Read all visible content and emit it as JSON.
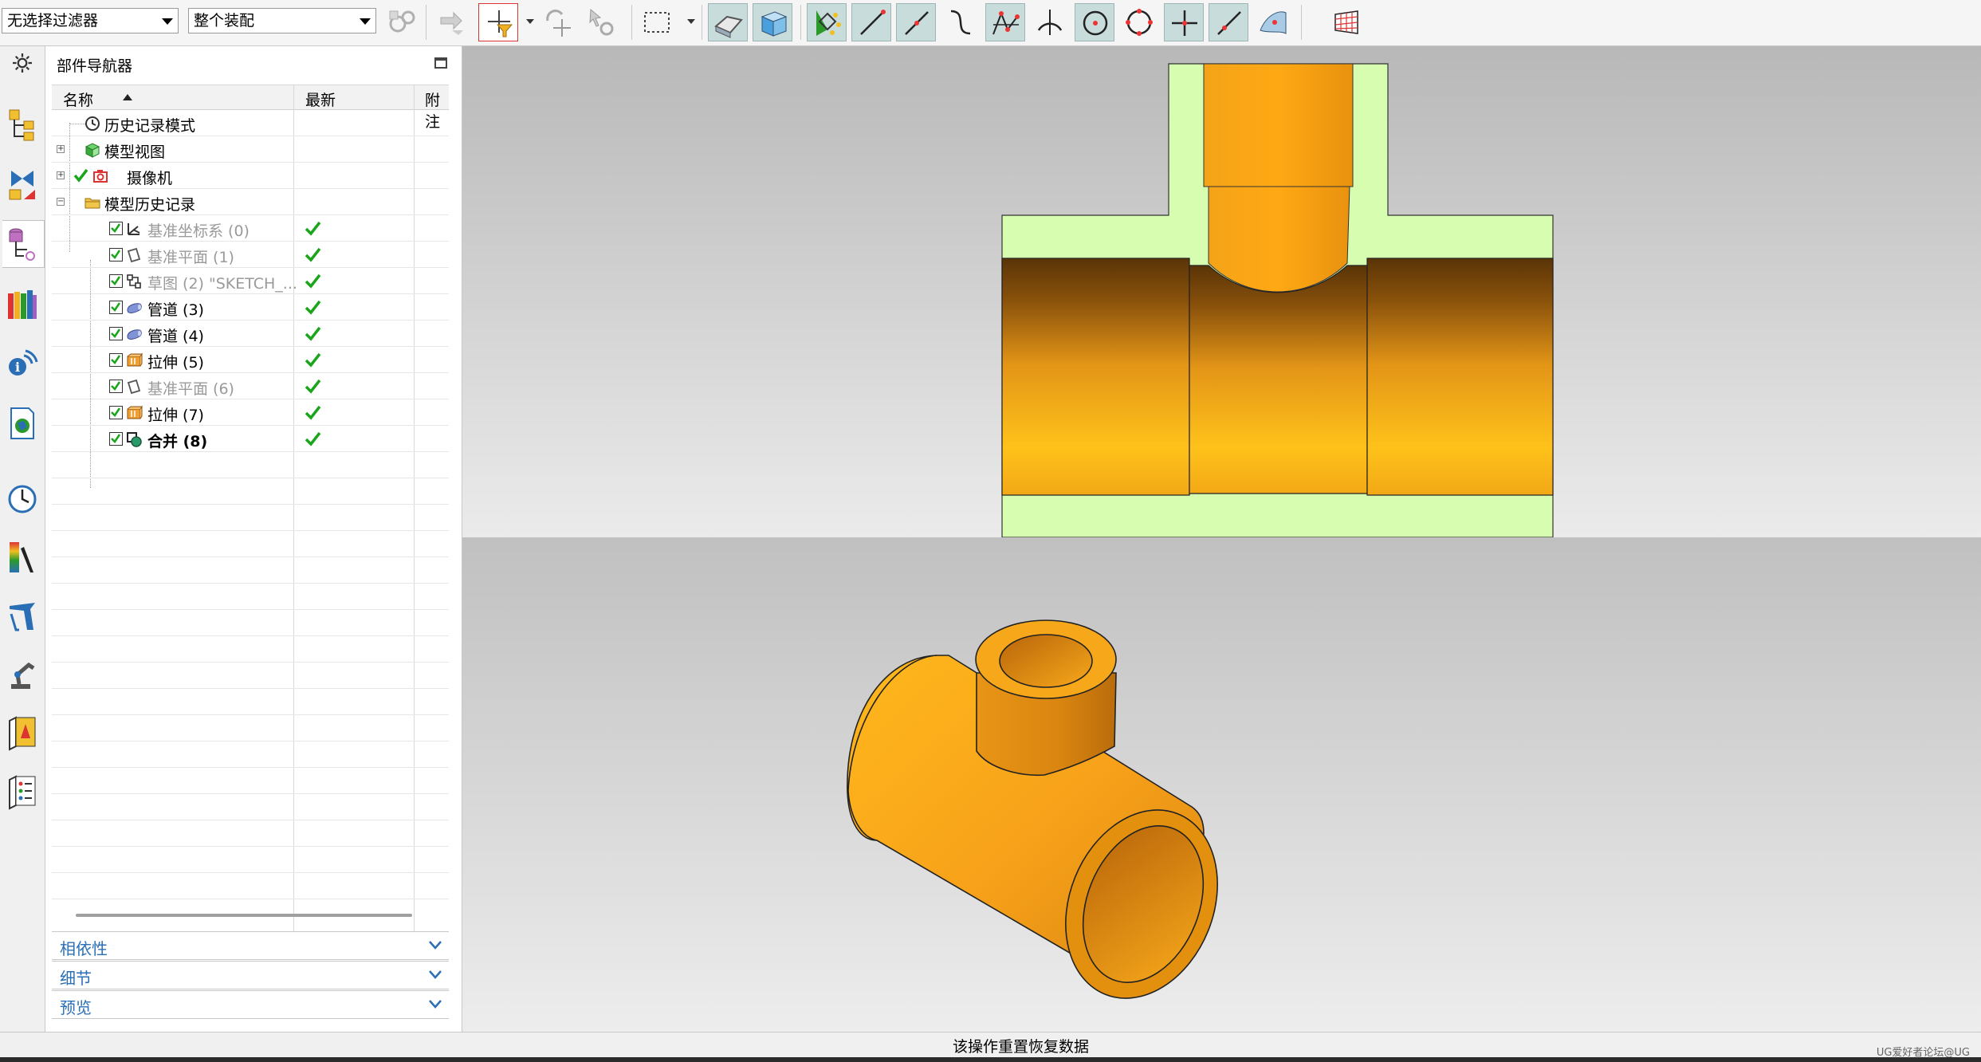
{
  "toolbar": {
    "filter_value": "无选择过滤器",
    "scope_value": "整个装配"
  },
  "navigator": {
    "title": "部件导航器",
    "columns": {
      "name": "名称",
      "latest": "最新",
      "notes": "附注"
    },
    "rows": [
      {
        "label": "历史记录模式"
      },
      {
        "label": "模型视图"
      },
      {
        "label": "摄像机"
      },
      {
        "label": "模型历史记录"
      },
      {
        "label": "基准坐标系 (0)",
        "latest": true
      },
      {
        "label": "基准平面 (1)",
        "latest": true
      },
      {
        "label": "草图 (2) \"SKETCH_...",
        "latest": true
      },
      {
        "label": "管道 (3)",
        "latest": true
      },
      {
        "label": "管道 (4)",
        "latest": true
      },
      {
        "label": "拉伸 (5)",
        "latest": true
      },
      {
        "label": "基准平面 (6)",
        "latest": true
      },
      {
        "label": "拉伸 (7)",
        "latest": true
      },
      {
        "label": "合并 (8)",
        "latest": true
      }
    ],
    "panels": {
      "dependencies": "相依性",
      "details": "细节",
      "preview": "预览"
    }
  },
  "status": {
    "message": "该操作重置恢复数据",
    "watermark": "UG爱好者论坛@UG"
  },
  "colors": {
    "part_orange": "#f7a21b",
    "section_fill": "#d6fdb0",
    "accent_blue": "#2a6fb5",
    "check_green": "#1aa51a"
  }
}
